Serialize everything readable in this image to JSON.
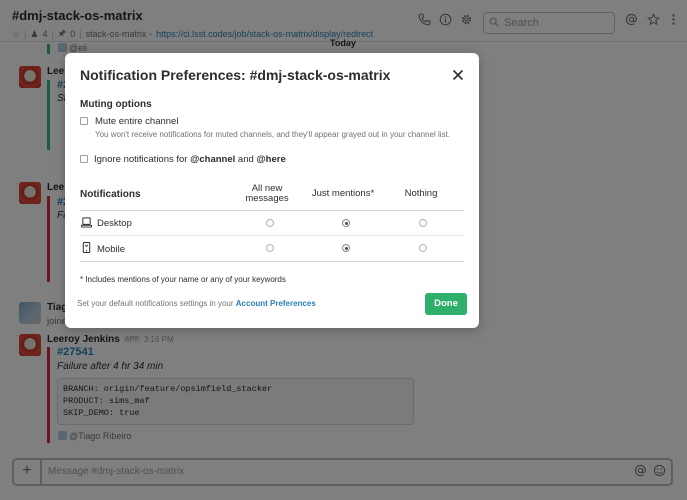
{
  "header": {
    "channel_name": "#dmj-stack-os-matrix",
    "members_count": "4",
    "pins_count": "0",
    "topic_prefix": "stack-os-matrix - ",
    "topic_link": "https://ci.lsst.codes/job/stack-os-matrix/display/redirect",
    "search_placeholder": "Search"
  },
  "messages": {
    "day_divider": "Today",
    "attribution_top": "@eli",
    "sender_partial_1": "Leer",
    "link_partial_1": "#2",
    "italic_partial_1": "St",
    "sender_partial_2": "Leer",
    "link_partial_2": "#2",
    "italic_partial_2": "Fa",
    "sender_partial_3": "Tiag",
    "text_partial_3": "joine",
    "last": {
      "sender": "Leeroy Jenkins",
      "tag": "APP",
      "time": "3:16 PM",
      "link": "#27541",
      "status": "Failure after 4 hr 34 min",
      "code_lines": [
        "BRANCH: origin/feature/opsimfield_stacker",
        "PRODUCT: sims_maf",
        "SKIP_DEMO: true"
      ],
      "attribution": "@Tiago Ribeiro"
    }
  },
  "composer": {
    "placeholder": "Message #dmj-stack-os-matrix"
  },
  "modal": {
    "title": "Notification Preferences: #dmj-stack-os-matrix",
    "muting_heading": "Muting options",
    "mute_label": "Mute entire channel",
    "mute_checked": false,
    "mute_description": "You won't receive notifications for muted channels, and they'll appear grayed out in your channel list.",
    "ignore_prefix": "Ignore notifications for ",
    "ignore_channel": "@channel",
    "ignore_and": " and ",
    "ignore_here": "@here",
    "ignore_checked": false,
    "table": {
      "header": "Notifications",
      "col_all_line1": "All new",
      "col_all_line2": "messages",
      "col_mentions": "Just mentions*",
      "col_nothing": "Nothing",
      "rows": [
        {
          "label": "Desktop",
          "icon": "desktop-icon",
          "selected": "Just mentions*"
        },
        {
          "label": "Mobile",
          "icon": "mobile-icon",
          "selected": "Just mentions*"
        }
      ]
    },
    "footnote": "* Includes mentions of your name or any of your keywords",
    "prefs_text": "Set your default notifications settings in your ",
    "prefs_link": "Account Preferences",
    "done_label": "Done"
  },
  "colors": {
    "link": "#2a80b9",
    "done_button": "#2eb06c",
    "attachment_failure": "#d72b3f",
    "attachment_success": "#2eb886"
  }
}
